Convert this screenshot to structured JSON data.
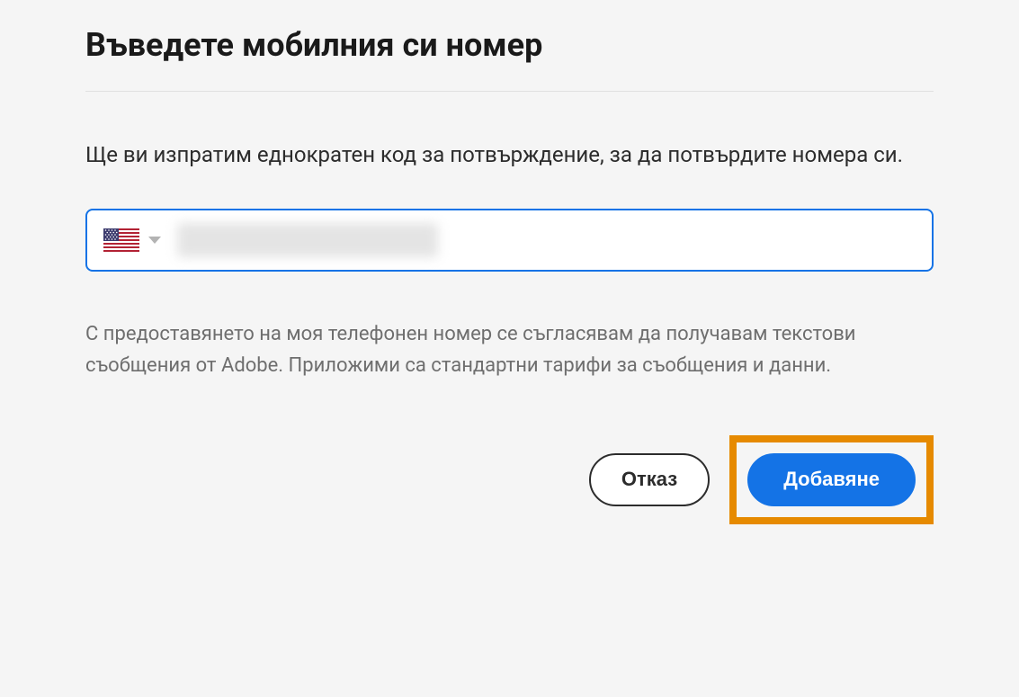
{
  "title": "Въведете мобилния си номер",
  "description": "Ще ви изпратим еднократен код за потвърждение, за да потвърдите номера си.",
  "phone": {
    "country_code": "US",
    "value": "",
    "placeholder": ""
  },
  "disclaimer": "С предоставянето на моя телефонен номер се съгласявам да получавам текстови съобщения от Adobe. Приложими са стандартни тарифи за съобщения и данни.",
  "buttons": {
    "cancel": "Отказ",
    "add": "Добавяне"
  }
}
